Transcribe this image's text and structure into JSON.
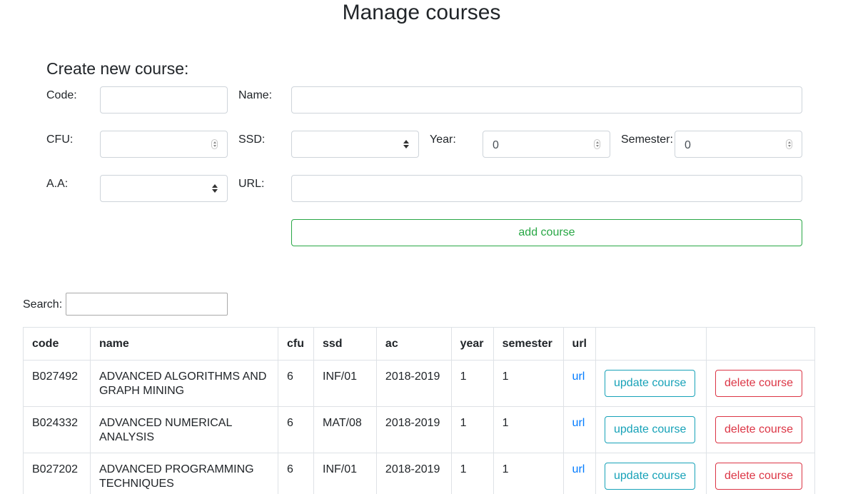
{
  "page": {
    "title": "Manage courses"
  },
  "create_form": {
    "title": "Create new course:",
    "code": {
      "label": "Code:",
      "value": ""
    },
    "name": {
      "label": "Name:",
      "value": ""
    },
    "cfu": {
      "label": "CFU:",
      "value": ""
    },
    "ssd": {
      "label": "SSD:",
      "value": ""
    },
    "year": {
      "label": "Year:",
      "value": "0"
    },
    "semester": {
      "label": "Semester:",
      "value": "0"
    },
    "aa": {
      "label": "A.A:",
      "value": ""
    },
    "url": {
      "label": "URL:",
      "value": ""
    },
    "add_button": "add course"
  },
  "search": {
    "label": "Search:",
    "value": ""
  },
  "table": {
    "headers": [
      "code",
      "name",
      "cfu",
      "ssd",
      "ac",
      "year",
      "semester",
      "url",
      "",
      ""
    ],
    "url_label": "url",
    "update_label": "update course",
    "delete_label": "delete course",
    "rows": [
      {
        "code": "B027492",
        "name": "ADVANCED ALGORITHMS AND GRAPH MINING",
        "cfu": "6",
        "ssd": "INF/01",
        "ac": "2018-2019",
        "year": "1",
        "semester": "1"
      },
      {
        "code": "B024332",
        "name": "ADVANCED NUMERICAL ANALYSIS",
        "cfu": "6",
        "ssd": "MAT/08",
        "ac": "2018-2019",
        "year": "1",
        "semester": "1"
      },
      {
        "code": "B027202",
        "name": "ADVANCED PROGRAMMING TECHNIQUES",
        "cfu": "6",
        "ssd": "INF/01",
        "ac": "2018-2019",
        "year": "1",
        "semester": "1"
      }
    ]
  },
  "colors": {
    "success": "#28a745",
    "info": "#17a2b8",
    "danger": "#dc3545",
    "link": "#007bff"
  }
}
